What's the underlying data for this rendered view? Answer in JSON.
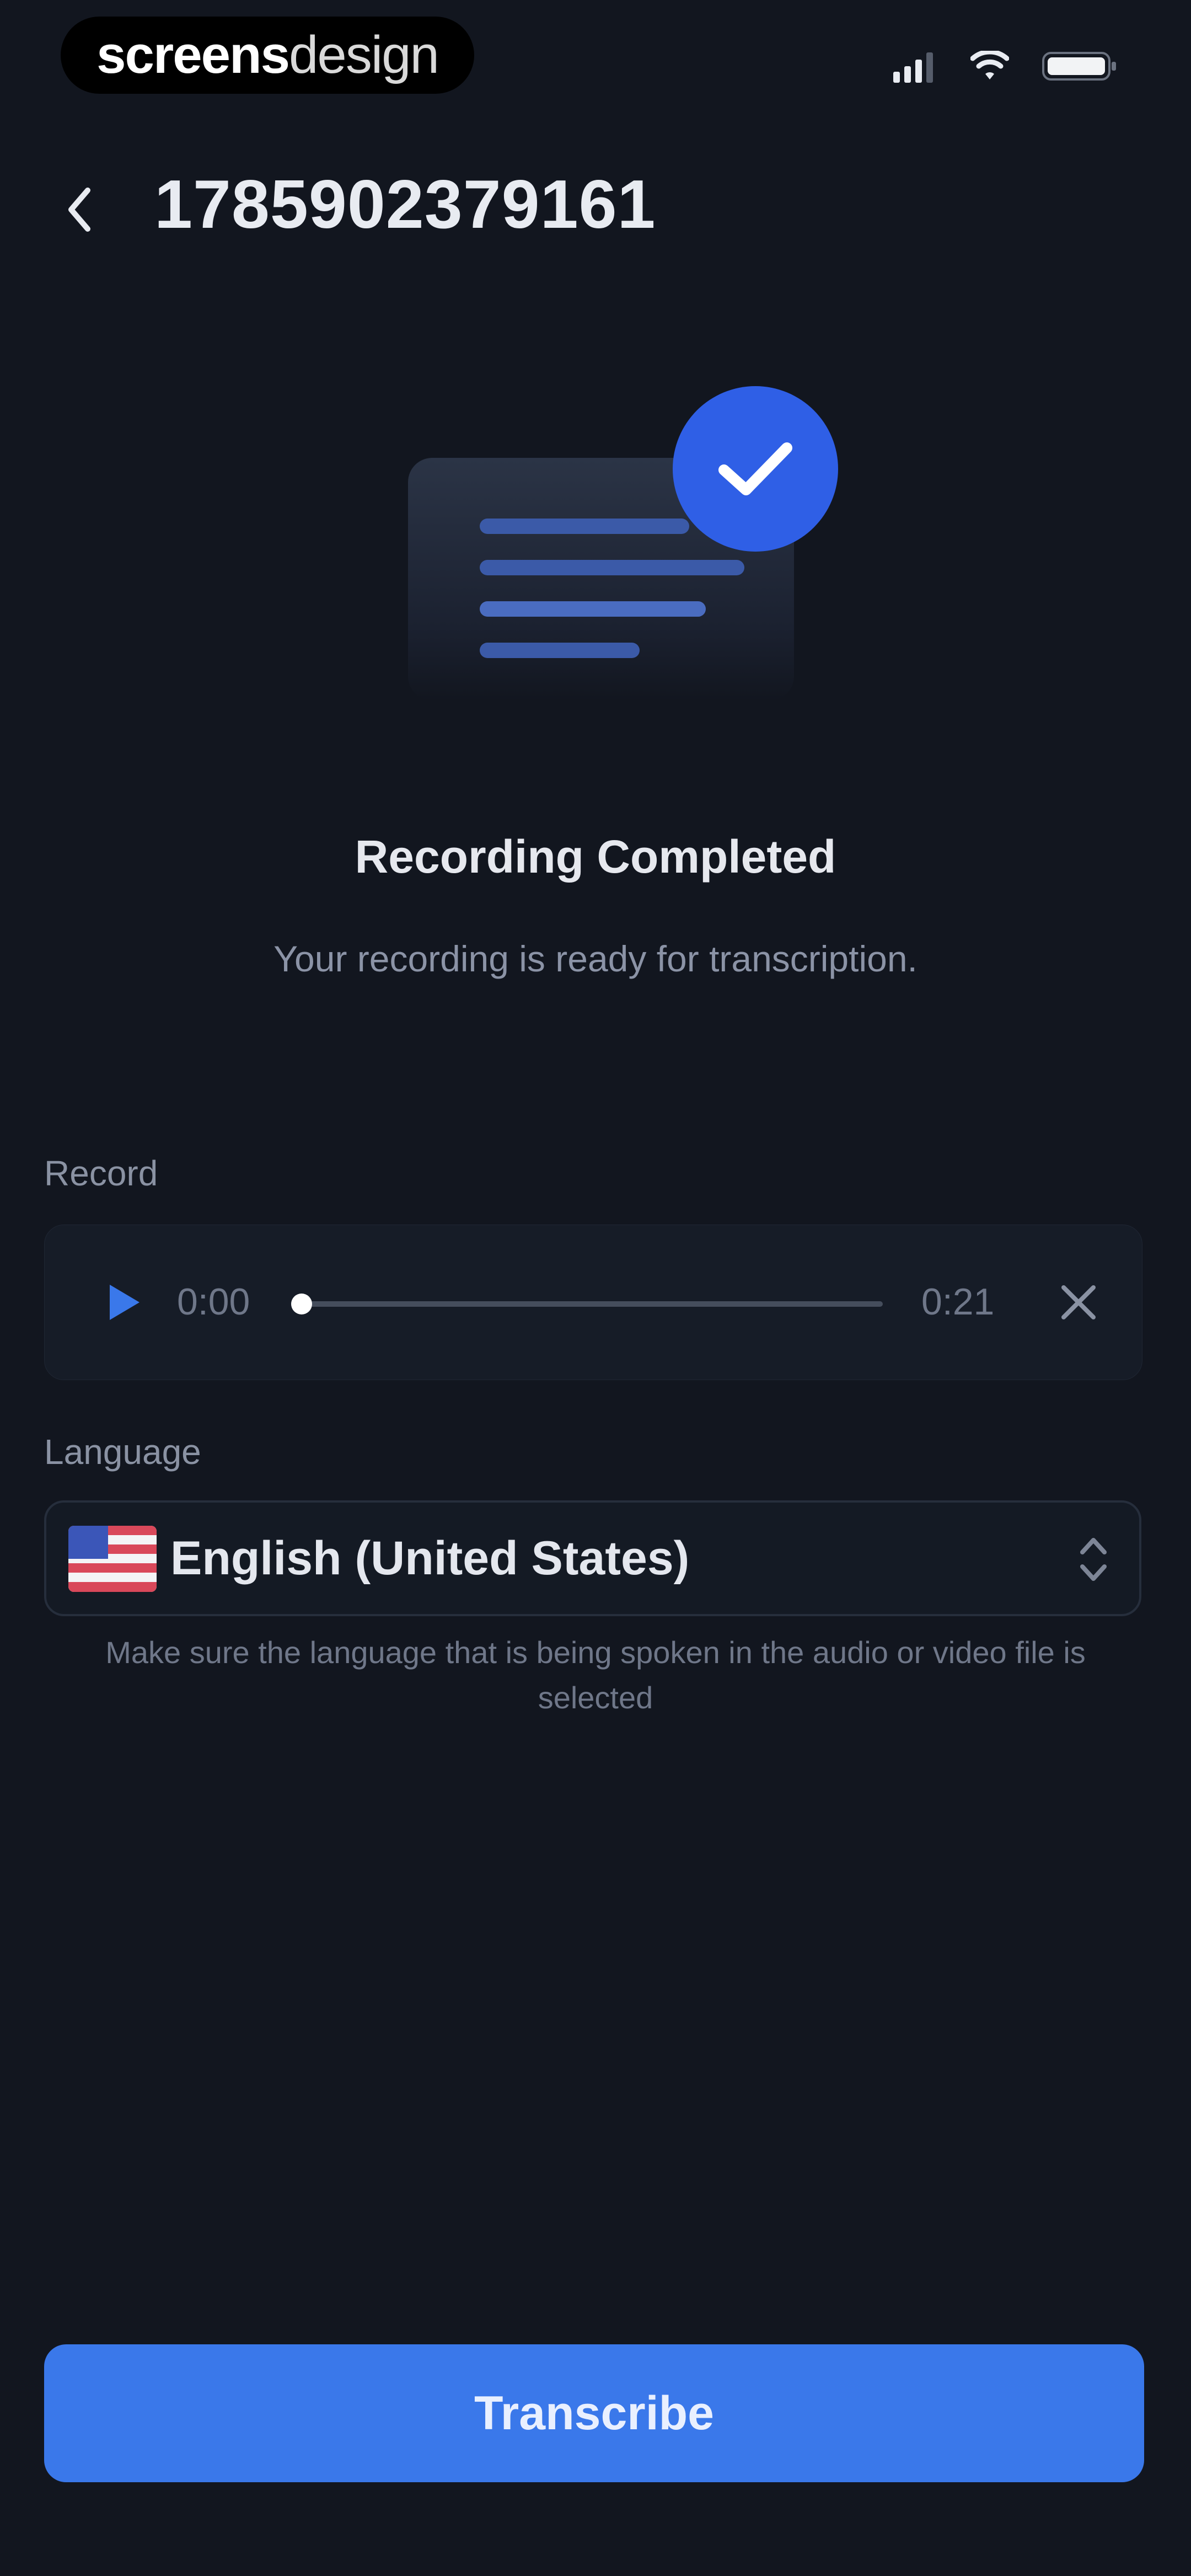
{
  "status_bar": {
    "brand_bold": "screens",
    "brand_thin": "design"
  },
  "header": {
    "title": "1785902379161"
  },
  "completion": {
    "heading": "Recording Completed",
    "subheading": "Your recording is ready for transcription."
  },
  "record": {
    "label": "Record",
    "current_time": "0:00",
    "duration": "0:21",
    "progress": 0.0
  },
  "language": {
    "label": "Language",
    "selected": "English (United States)",
    "hint": "Make sure the language that is being spoken in the audio or video file is selected"
  },
  "actions": {
    "transcribe_label": "Transcribe"
  },
  "colors": {
    "background": "#12161f",
    "accent": "#3a78ea",
    "check_circle": "#2f5fe6"
  },
  "icons": {
    "back": "chevron-left-icon",
    "play": "play-icon",
    "close": "close-icon",
    "check": "check-icon",
    "flag": "us-flag-icon",
    "select": "chevron-up-down-icon"
  }
}
